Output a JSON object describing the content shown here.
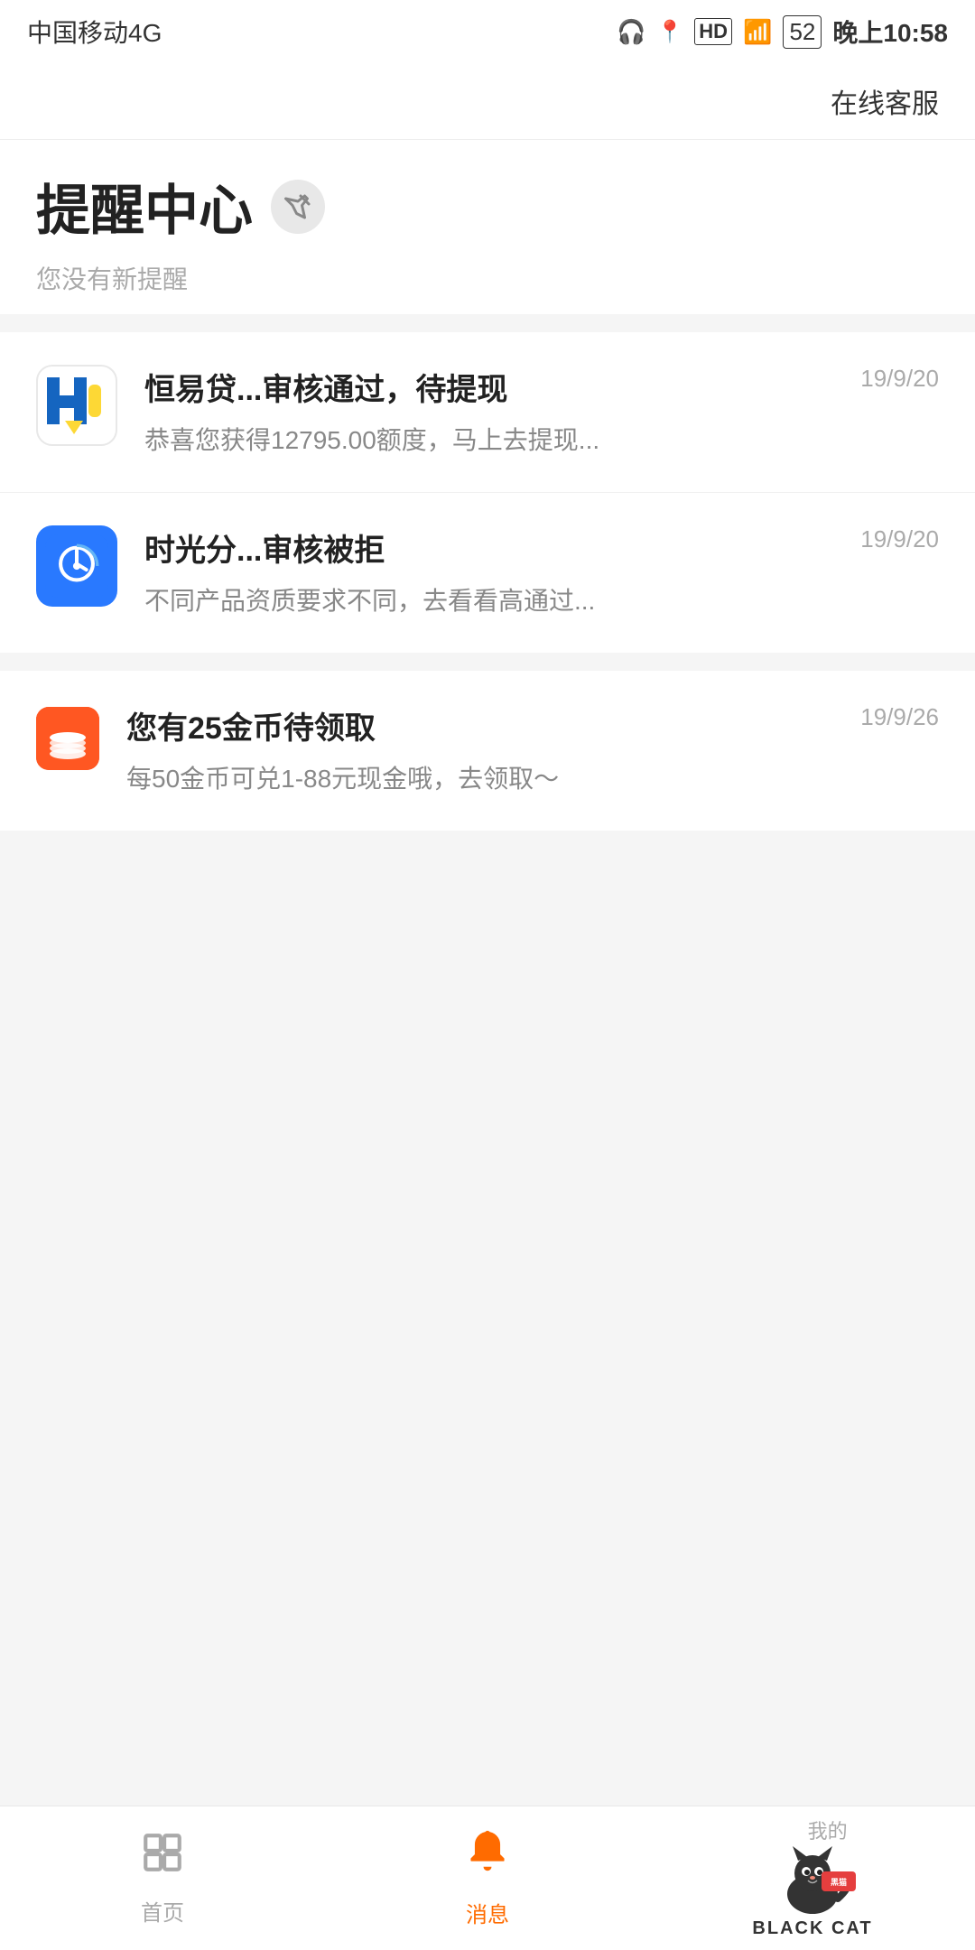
{
  "statusBar": {
    "carrier": "中国移动4G",
    "time": "晚上10:58",
    "battery": "52"
  },
  "header": {
    "onlineService": "在线客服"
  },
  "pageTitle": {
    "title": "提醒中心",
    "noReminder": "您没有新提醒"
  },
  "notifications": [
    {
      "id": 1,
      "iconType": "hyd",
      "title": "恒易贷...审核通过，待提现",
      "desc": "恭喜您获得12795.00额度，马上去提现...",
      "date": "19/9/20"
    },
    {
      "id": 2,
      "iconType": "sgf",
      "title": "时光分...审核被拒",
      "desc": "不同产品资质要求不同，去看看高通过...",
      "date": "19/9/20"
    }
  ],
  "coinNotification": {
    "title": "您有25金币待领取",
    "desc": "每50金币可兑1-88元现金哦，去领取～",
    "date": "19/9/26"
  },
  "tabBar": {
    "items": [
      {
        "id": "home",
        "label": "首页",
        "active": false
      },
      {
        "id": "message",
        "label": "消息",
        "active": true
      },
      {
        "id": "mine",
        "label": "我的",
        "active": false
      }
    ]
  },
  "watermark": {
    "line1": "我的",
    "line2": "BLACK CAT"
  }
}
